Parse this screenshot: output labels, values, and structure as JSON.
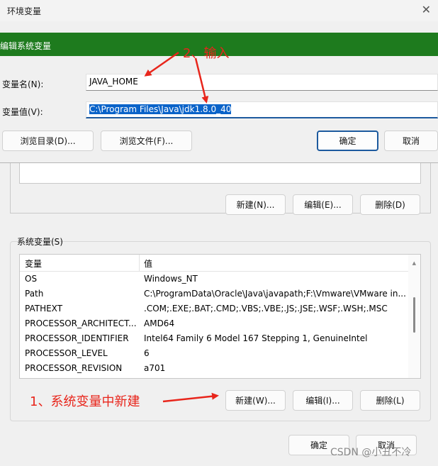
{
  "env_window": {
    "title": "环境变量",
    "close_glyph": "✕",
    "user_buttons": {
      "new": "新建(N)...",
      "edit": "编辑(E)...",
      "delete": "删除(D)"
    },
    "system_group_label": "系统变量(S)",
    "system_table": {
      "headers": {
        "name": "变量",
        "value": "值"
      },
      "rows": [
        {
          "name": "OS",
          "value": "Windows_NT"
        },
        {
          "name": "Path",
          "value": "C:\\ProgramData\\Oracle\\Java\\javapath;F:\\Vmware\\VMware in..."
        },
        {
          "name": "PATHEXT",
          "value": ".COM;.EXE;.BAT;.CMD;.VBS;.VBE;.JS;.JSE;.WSF;.WSH;.MSC"
        },
        {
          "name": "PROCESSOR_ARCHITECT...",
          "value": "AMD64"
        },
        {
          "name": "PROCESSOR_IDENTIFIER",
          "value": "Intel64 Family 6 Model 167 Stepping 1, GenuineIntel"
        },
        {
          "name": "PROCESSOR_LEVEL",
          "value": "6"
        },
        {
          "name": "PROCESSOR_REVISION",
          "value": "a701"
        }
      ]
    },
    "system_buttons": {
      "new": "新建(W)...",
      "edit": "编辑(I)...",
      "delete": "删除(L)"
    },
    "ok": "确定",
    "cancel": "取消"
  },
  "edit_dialog": {
    "title": "编辑系统变量",
    "name_label": "变量名(N):",
    "name_value": "JAVA_HOME",
    "value_label": "变量值(V):",
    "value_value": "C:\\Program Files\\Java\\jdk1.8.0_40",
    "browse_dir": "浏览目录(D)...",
    "browse_file": "浏览文件(F)...",
    "ok": "确定",
    "cancel": "取消"
  },
  "annotations": {
    "step1": "1、系统变量中新建",
    "step2": "2、输入",
    "color": "#e8251b"
  },
  "watermark": "CSDN @小丑不冷"
}
